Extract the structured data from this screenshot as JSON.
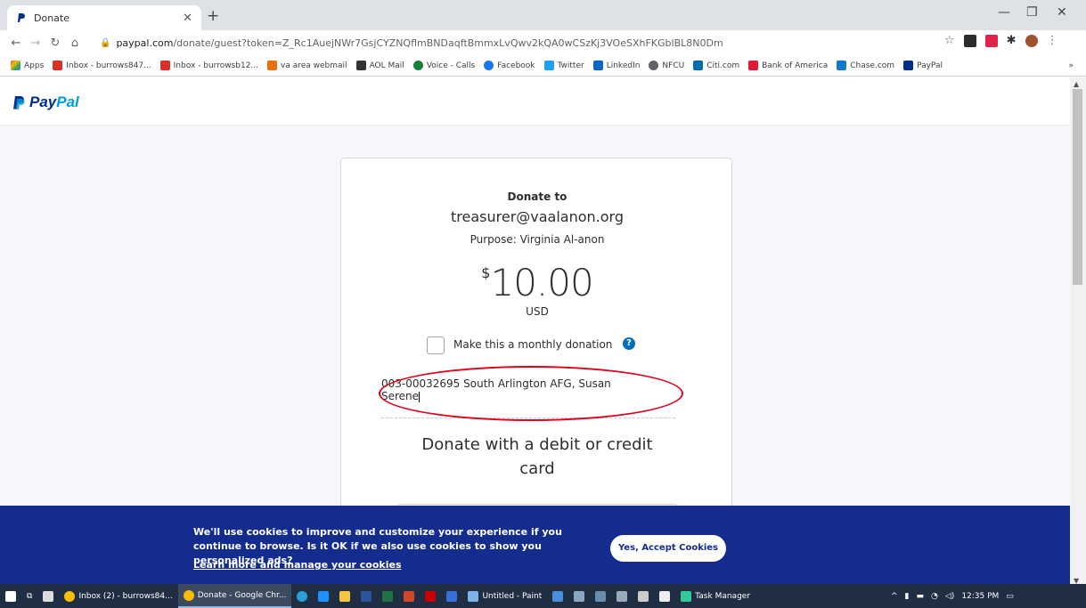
{
  "browser": {
    "tab_title": "Donate",
    "new_tab": "+",
    "url_host": "paypal.com",
    "url_path": "/donate/guest?token=Z_Rc1AuejNWr7GsjCYZNQflmBNDaqftBmmxLvQwv2kQA0wCSzKj3VOeSXhFKGblBL8N0Dm",
    "bookmarks": [
      "Apps",
      "Inbox - burrows847...",
      "Inbox - burrowsb12...",
      "va area webmail",
      "AOL Mail",
      "Voice - Calls",
      "Facebook",
      "Twitter",
      "LinkedIn",
      "NFCU",
      "Citi.com",
      "Bank of America",
      "Chase.com",
      "PayPal"
    ],
    "bookmark_overflow": "»"
  },
  "paypal": {
    "logo_a": "Pay",
    "logo_b": "Pal",
    "donate_to": "Donate to",
    "recipient": "treasurer@vaalanon.org",
    "purpose": "Purpose: Virginia Al-anon",
    "currency_symbol": "$",
    "amount": "10.00",
    "currency_code": "USD",
    "monthly_label": "Make this a monthly donation",
    "help_glyph": "?",
    "note_line1": "003-00032695 South Arlington AFG, Susan",
    "note_line2": "Serene",
    "debit_title": "Donate with a debit or credit card"
  },
  "cookie": {
    "text": "We'll use cookies to improve and customize your experience if you continue to browse. Is it OK if we also use cookies to show you personalized ads?",
    "link": "Learn more and manage your cookies",
    "accept": "Yes, Accept Cookies"
  },
  "taskbar": {
    "items": [
      "Inbox (2) - burrows84...",
      "Donate - Google Chr...",
      "Untitled - Paint",
      "Task Manager"
    ],
    "clock": "12:35 PM"
  },
  "colors": {
    "paypal_dark": "#003087",
    "paypal_light": "#009cde",
    "cookie_bg": "#142c8e",
    "annotation_red": "#e0001b"
  }
}
